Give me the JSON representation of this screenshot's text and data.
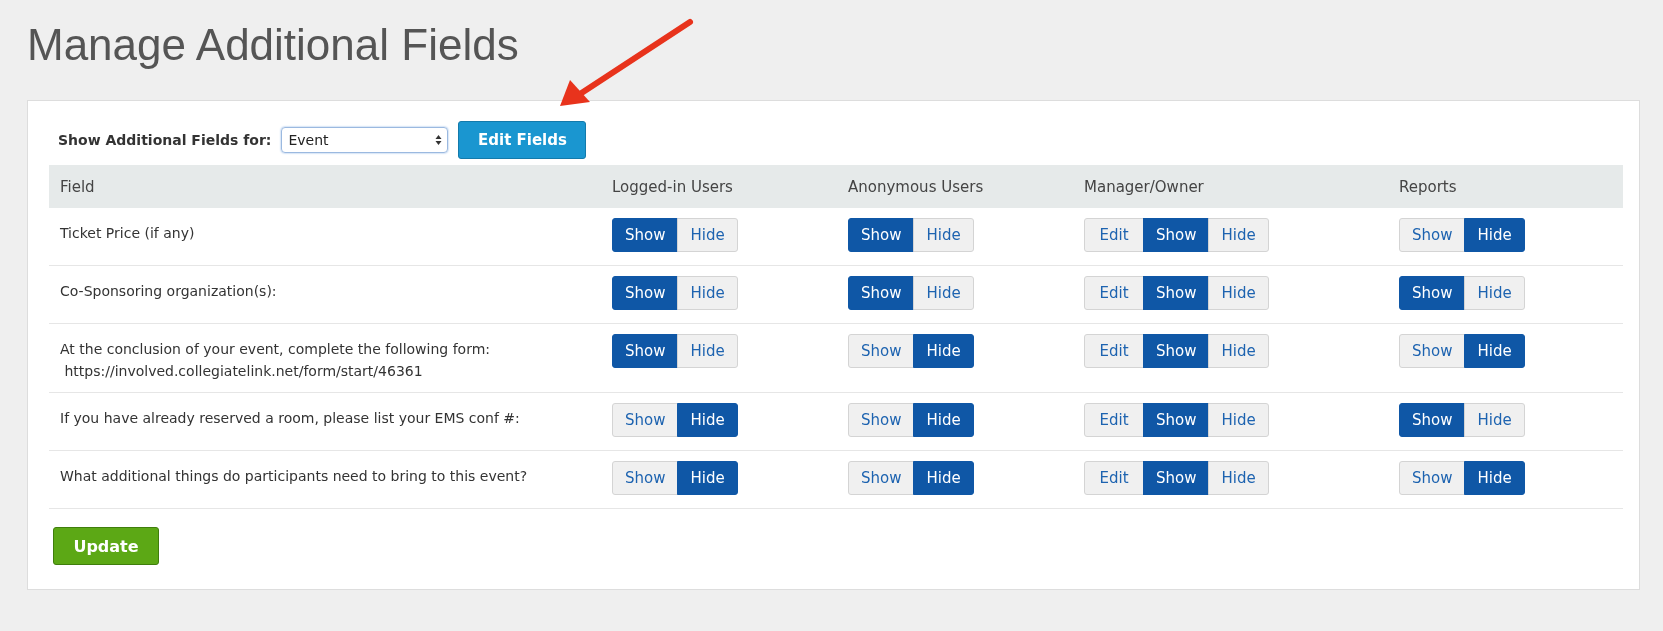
{
  "title": "Manage Additional Fields",
  "filter": {
    "label": "Show Additional Fields for:",
    "value": "Event",
    "button": "Edit Fields"
  },
  "table": {
    "columns": [
      "Field",
      "Logged-in Users",
      "Anonymous Users",
      "Manager/Owner",
      "Reports"
    ],
    "rows": [
      {
        "field": [
          "Ticket Price (if any)"
        ],
        "groups": [
          [
            {
              "label": "Show",
              "selected": true
            },
            {
              "label": "Hide",
              "selected": false
            }
          ],
          [
            {
              "label": "Show",
              "selected": true
            },
            {
              "label": "Hide",
              "selected": false
            }
          ],
          [
            {
              "label": "Edit",
              "selected": false
            },
            {
              "label": "Show",
              "selected": true
            },
            {
              "label": "Hide",
              "selected": false
            }
          ],
          [
            {
              "label": "Show",
              "selected": false
            },
            {
              "label": "Hide",
              "selected": true
            }
          ]
        ]
      },
      {
        "field": [
          "Co-Sponsoring organization(s):"
        ],
        "groups": [
          [
            {
              "label": "Show",
              "selected": true
            },
            {
              "label": "Hide",
              "selected": false
            }
          ],
          [
            {
              "label": "Show",
              "selected": true
            },
            {
              "label": "Hide",
              "selected": false
            }
          ],
          [
            {
              "label": "Edit",
              "selected": false
            },
            {
              "label": "Show",
              "selected": true
            },
            {
              "label": "Hide",
              "selected": false
            }
          ],
          [
            {
              "label": "Show",
              "selected": true
            },
            {
              "label": "Hide",
              "selected": false
            }
          ]
        ]
      },
      {
        "field": [
          "At the conclusion of your event, complete the following form:",
          "https://involved.collegiatelink.net/form/start/46361"
        ],
        "groups": [
          [
            {
              "label": "Show",
              "selected": true
            },
            {
              "label": "Hide",
              "selected": false
            }
          ],
          [
            {
              "label": "Show",
              "selected": false
            },
            {
              "label": "Hide",
              "selected": true
            }
          ],
          [
            {
              "label": "Edit",
              "selected": false
            },
            {
              "label": "Show",
              "selected": true
            },
            {
              "label": "Hide",
              "selected": false
            }
          ],
          [
            {
              "label": "Show",
              "selected": false
            },
            {
              "label": "Hide",
              "selected": true
            }
          ]
        ]
      },
      {
        "field": [
          "If you have already reserved a room, please list your EMS conf #:"
        ],
        "groups": [
          [
            {
              "label": "Show",
              "selected": false
            },
            {
              "label": "Hide",
              "selected": true
            }
          ],
          [
            {
              "label": "Show",
              "selected": false
            },
            {
              "label": "Hide",
              "selected": true
            }
          ],
          [
            {
              "label": "Edit",
              "selected": false
            },
            {
              "label": "Show",
              "selected": true
            },
            {
              "label": "Hide",
              "selected": false
            }
          ],
          [
            {
              "label": "Show",
              "selected": true
            },
            {
              "label": "Hide",
              "selected": false
            }
          ]
        ]
      },
      {
        "field": [
          "What additional things do participants need to bring to this event?"
        ],
        "groups": [
          [
            {
              "label": "Show",
              "selected": false
            },
            {
              "label": "Hide",
              "selected": true
            }
          ],
          [
            {
              "label": "Show",
              "selected": false
            },
            {
              "label": "Hide",
              "selected": true
            }
          ],
          [
            {
              "label": "Edit",
              "selected": false
            },
            {
              "label": "Show",
              "selected": true
            },
            {
              "label": "Hide",
              "selected": false
            }
          ],
          [
            {
              "label": "Show",
              "selected": false
            },
            {
              "label": "Hide",
              "selected": true
            }
          ]
        ]
      }
    ]
  },
  "update_button": "Update"
}
